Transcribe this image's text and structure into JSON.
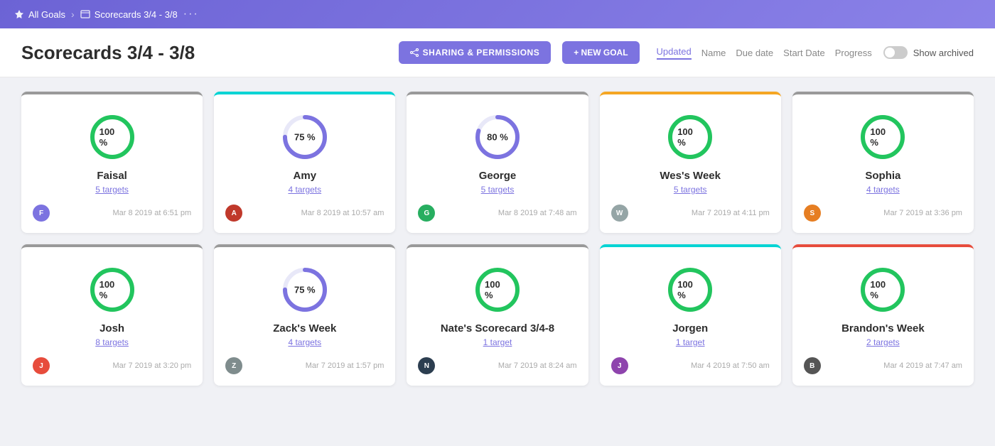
{
  "nav": {
    "all_goals_label": "All Goals",
    "scorecard_label": "Scorecards 3/4 - 3/8",
    "dots": "···"
  },
  "header": {
    "title": "Scorecards 3/4 - 3/8",
    "sharing_btn": "SHARING & PERMISSIONS",
    "new_goal_btn": "+ NEW GOAL",
    "sort_options": [
      "Updated",
      "Name",
      "Due date",
      "Start Date",
      "Progress"
    ],
    "active_sort": "Updated",
    "show_archived_label": "Show archived"
  },
  "cards_row1": [
    {
      "name": "Faisal",
      "targets": "5 targets",
      "progress": 100,
      "top_color": "gray",
      "date": "Mar 8 2019 at 6:51 pm",
      "avatar_color": "#7c73e0",
      "avatar_text": "F"
    },
    {
      "name": "Amy",
      "targets": "4 targets",
      "progress": 75,
      "top_color": "cyan",
      "date": "Mar 8 2019 at 10:57 am",
      "avatar_color": "#c0392b",
      "avatar_text": "A"
    },
    {
      "name": "George",
      "targets": "5 targets",
      "progress": 80,
      "top_color": "gray",
      "date": "Mar 8 2019 at 7:48 am",
      "avatar_color": "#27ae60",
      "avatar_text": "G"
    },
    {
      "name": "Wes's Week",
      "targets": "5 targets",
      "progress": 100,
      "top_color": "orange",
      "date": "Mar 7 2019 at 4:11 pm",
      "avatar_color": "#95a5a6",
      "avatar_text": "W"
    },
    {
      "name": "Sophia",
      "targets": "4 targets",
      "progress": 100,
      "top_color": "gray",
      "date": "Mar 7 2019 at 3:36 pm",
      "avatar_color": "#e67e22",
      "avatar_text": "S"
    }
  ],
  "cards_row2": [
    {
      "name": "Josh",
      "targets": "8 targets",
      "progress": 100,
      "top_color": "gray",
      "date": "Mar 7 2019 at 3:20 pm",
      "avatar_color": "#e74c3c",
      "avatar_text": "J"
    },
    {
      "name": "Zack's Week",
      "targets": "4 targets",
      "progress": 75,
      "top_color": "gray",
      "date": "Mar 7 2019 at 1:57 pm",
      "avatar_color": "#7f8c8d",
      "avatar_text": "Z"
    },
    {
      "name": "Nate's Scorecard 3/4-8",
      "targets": "1 target",
      "progress": 100,
      "top_color": "gray",
      "date": "Mar 7 2019 at 8:24 am",
      "avatar_color": "#2c3e50",
      "avatar_text": "N"
    },
    {
      "name": "Jorgen",
      "targets": "1 target",
      "progress": 100,
      "top_color": "cyan",
      "date": "Mar 4 2019 at 7:50 am",
      "avatar_color": "#8e44ad",
      "avatar_text": "J"
    },
    {
      "name": "Brandon's Week",
      "targets": "2 targets",
      "progress": 100,
      "top_color": "red",
      "date": "Mar 4 2019 at 7:47 am",
      "avatar_color": "#555",
      "avatar_text": "B"
    }
  ]
}
